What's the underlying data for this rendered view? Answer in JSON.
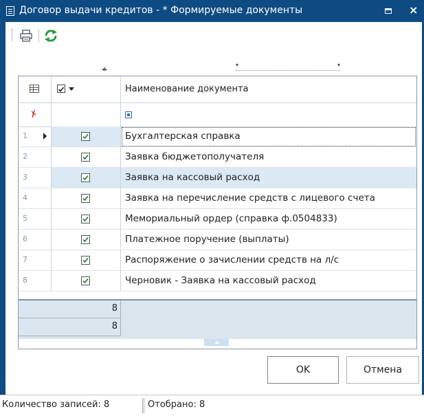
{
  "window": {
    "title": "Договор выдачи кредитов - * Формируемые документы"
  },
  "toolbar": {
    "icons": [
      "printer-icon",
      "refresh-icon"
    ]
  },
  "grid": {
    "header": {
      "name_column": "Наименование документа"
    },
    "rows": [
      {
        "num": "1",
        "checked": true,
        "name": "Бухгалтерская справка"
      },
      {
        "num": "2",
        "checked": true,
        "name": "Заявка бюджетополучателя"
      },
      {
        "num": "3",
        "checked": true,
        "name": "Заявка на кассовый расход"
      },
      {
        "num": "4",
        "checked": true,
        "name": "Заявка на перечисление средств с лицевого счета"
      },
      {
        "num": "5",
        "checked": true,
        "name": "Мемориальный ордер (справка ф.0504833)"
      },
      {
        "num": "6",
        "checked": true,
        "name": "Платежное поручение (выплаты)"
      },
      {
        "num": "7",
        "checked": true,
        "name": "Распоряжение о зачислении средств на л/с"
      },
      {
        "num": "8",
        "checked": true,
        "name": "Черновик - Заявка на кассовый расход"
      }
    ],
    "summary": [
      "8",
      "8"
    ]
  },
  "buttons": {
    "ok": "OK",
    "cancel": "Отмена"
  },
  "status": {
    "count": "Количество записей: 8",
    "filtered": "Отобрано: 8"
  },
  "colors": {
    "title_bar": "#0e4b83",
    "selection": "#dbe9f5",
    "check": "#2e8b3a"
  }
}
